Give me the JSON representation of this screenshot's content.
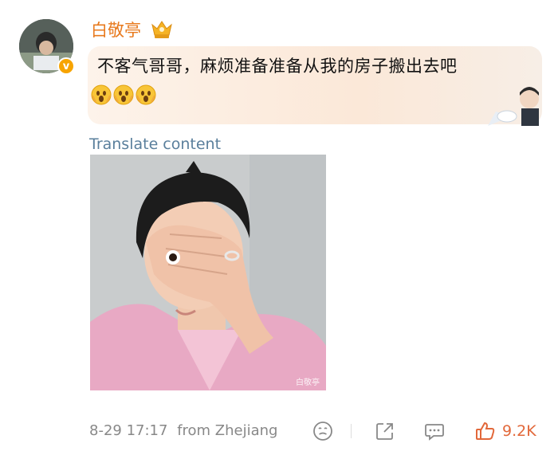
{
  "post": {
    "username": "白敬亭",
    "text": "不客气哥哥，麻烦准备准备从我的房子搬出去吧",
    "translate_label": "Translate content",
    "emoji_count": 3
  },
  "image": {
    "watermark": "白敬亭"
  },
  "footer": {
    "timestamp": "8-29 17:17",
    "location": "from Zhejiang",
    "likes": "9.2K"
  },
  "colors": {
    "username": "#e87a1e",
    "translate": "#5a7f9c",
    "likes": "#e2683a",
    "meta": "#888888"
  },
  "icons": {
    "badge": "verified-v-icon",
    "crown": "crown-icon",
    "react": "emoji-react-icon",
    "share": "share-icon",
    "comment": "comment-icon",
    "like": "thumbs-up-icon"
  }
}
